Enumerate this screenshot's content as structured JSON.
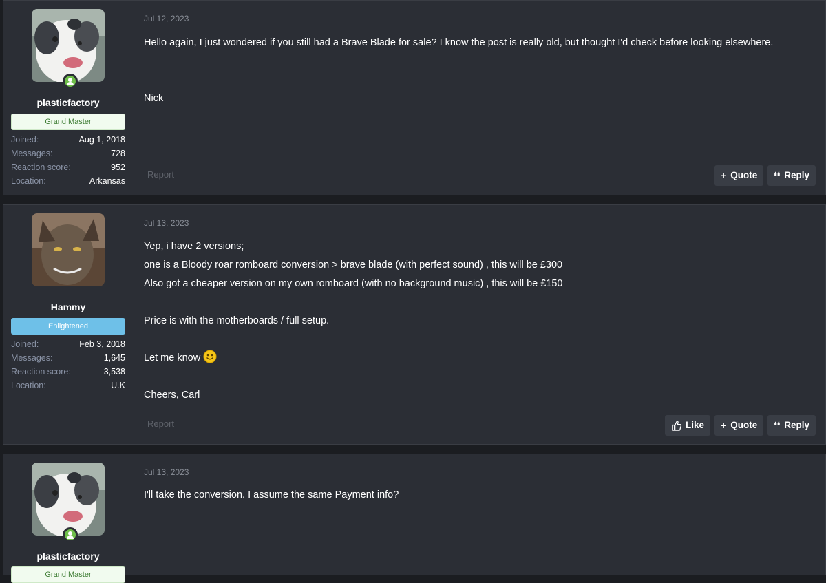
{
  "posts": [
    {
      "author": "plasticfactory",
      "rank": "Grand Master",
      "stats": [
        {
          "label": "Joined:",
          "value": "Aug 1, 2018"
        },
        {
          "label": "Messages:",
          "value": "728"
        },
        {
          "label": "Reaction score:",
          "value": "952"
        },
        {
          "label": "Location:",
          "value": "Arkansas"
        }
      ],
      "date": "Jul 12, 2023",
      "lines": [
        "Hello again, I just wondered if you still had a Brave Blade for sale? I know the post is really old, but thought I'd check before looking elsewhere.",
        "",
        "",
        "Nick"
      ],
      "report": "Report",
      "actions": {
        "quote": "Quote",
        "reply": "Reply"
      }
    },
    {
      "author": "Hammy",
      "rank": "Enlightened",
      "stats": [
        {
          "label": "Joined:",
          "value": "Feb 3, 2018"
        },
        {
          "label": "Messages:",
          "value": "1,645"
        },
        {
          "label": "Reaction score:",
          "value": "3,538"
        },
        {
          "label": "Location:",
          "value": "U.K"
        }
      ],
      "date": "Jul 13, 2023",
      "lines": [
        "Yep, i have 2 versions;",
        "one is a Bloody roar romboard conversion > brave blade (with perfect sound) , this will be £300",
        "Also got a cheaper version on my own romboard (with no background music) , this will be £150",
        "",
        "Price is with the motherboards / full setup.",
        "",
        "Let me know",
        "",
        "Cheers, Carl"
      ],
      "report": "Report",
      "actions": {
        "like": "Like",
        "quote": "Quote",
        "reply": "Reply"
      }
    },
    {
      "author": "plasticfactory",
      "rank": "Grand Master",
      "date": "Jul 13, 2023",
      "lines": [
        "I'll take the conversion. I assume the same Payment info?"
      ]
    }
  ],
  "icons": {
    "quote": "plus-icon",
    "reply": "quote-marks-icon",
    "like": "thumbs-up-icon",
    "smiley": "smiley-emoji-icon",
    "online": "online-status-icon"
  },
  "colors": {
    "online": "#6fbf4a",
    "grand_master_badge": "#f1fbef",
    "enlightened_badge": "#6ec0e8",
    "background": "#2b2e35"
  }
}
